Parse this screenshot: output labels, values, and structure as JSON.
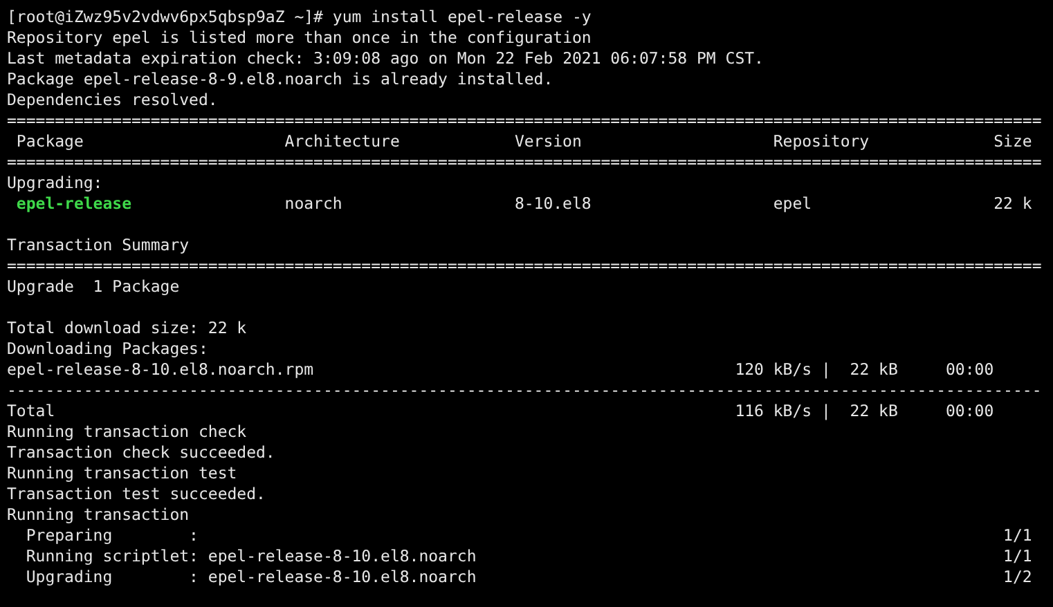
{
  "terminal": {
    "lines": [
      {
        "kind": "text",
        "text": "[root@iZwz95v2vdwv6px5qbsp9aZ ~]# yum install epel-release -y"
      },
      {
        "kind": "text",
        "text": "Repository epel is listed more than once in the configuration"
      },
      {
        "kind": "text",
        "text": "Last metadata expiration check: 3:09:08 ago on Mon 22 Feb 2021 06:07:58 PM CST."
      },
      {
        "kind": "text",
        "text": "Package epel-release-8-9.el8.noarch is already installed."
      },
      {
        "kind": "text",
        "text": "Dependencies resolved."
      },
      {
        "kind": "rule",
        "text": "============================================================================================================"
      },
      {
        "kind": "header",
        "cells": [
          "Package",
          "Architecture",
          "Version",
          "Repository",
          "Size"
        ]
      },
      {
        "kind": "rule",
        "text": "============================================================================================================"
      },
      {
        "kind": "text",
        "text": "Upgrading:"
      },
      {
        "kind": "package",
        "cells": [
          "epel-release",
          "noarch",
          "8-10.el8",
          "epel",
          "22 k"
        ]
      },
      {
        "kind": "blank"
      },
      {
        "kind": "text",
        "text": "Transaction Summary"
      },
      {
        "kind": "rule",
        "text": "============================================================================================================"
      },
      {
        "kind": "text",
        "text": "Upgrade  1 Package"
      },
      {
        "kind": "blank"
      },
      {
        "kind": "text",
        "text": "Total download size: 22 k"
      },
      {
        "kind": "text",
        "text": "Downloading Packages:"
      },
      {
        "kind": "download",
        "name": "epel-release-8-10.el8.noarch.rpm",
        "stats": "120 kB/s |  22 kB     00:00"
      },
      {
        "kind": "rule",
        "text": "------------------------------------------------------------------------------------------------------------"
      },
      {
        "kind": "download",
        "name": "Total",
        "stats": "116 kB/s |  22 kB     00:00"
      },
      {
        "kind": "text",
        "text": "Running transaction check"
      },
      {
        "kind": "text",
        "text": "Transaction check succeeded."
      },
      {
        "kind": "text",
        "text": "Running transaction test"
      },
      {
        "kind": "text",
        "text": "Transaction test succeeded."
      },
      {
        "kind": "text",
        "text": "Running transaction"
      },
      {
        "kind": "step",
        "text": "  Preparing        :",
        "count": "1/1"
      },
      {
        "kind": "step",
        "text": "  Running scriptlet: epel-release-8-10.el8.noarch",
        "count": "1/1"
      },
      {
        "kind": "step",
        "text": "  Upgrading        : epel-release-8-10.el8.noarch",
        "count": "1/2"
      }
    ]
  }
}
